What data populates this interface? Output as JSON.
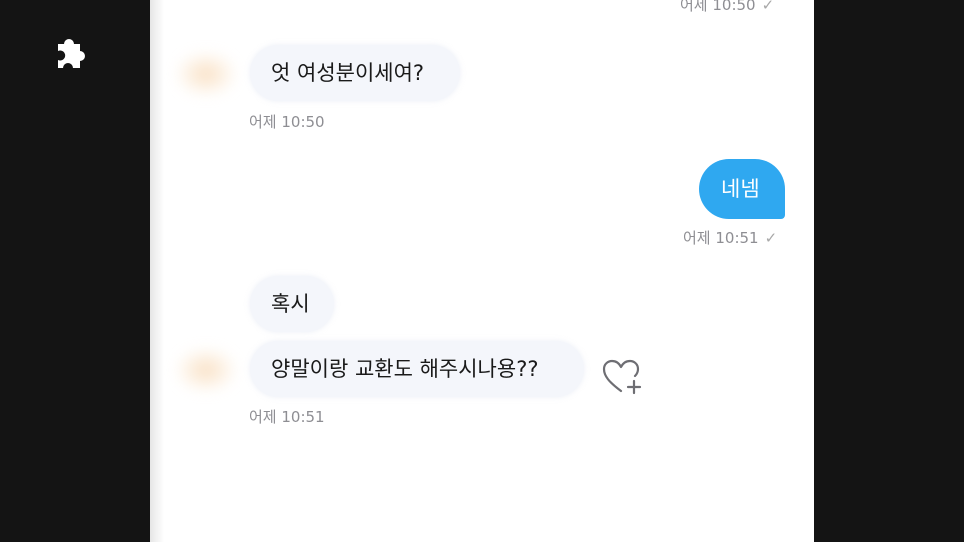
{
  "chat": {
    "messages": [
      {
        "kind": "outgoing_time_partial",
        "time": "어제 10:50",
        "check": "✓"
      },
      {
        "kind": "incoming",
        "text": "엇 여성분이세여?",
        "time": "어제 10:50"
      },
      {
        "kind": "outgoing",
        "text": "네넴",
        "time": "어제 10:51",
        "check": "✓"
      },
      {
        "kind": "incoming",
        "text": "혹시"
      },
      {
        "kind": "incoming",
        "text": "양말이랑 교환도 해주시나용??",
        "time": "어제 10:51"
      }
    ]
  },
  "colors": {
    "outgoing_bubble": "#2fa8f0",
    "incoming_bubble": "#f4f6fb",
    "background": "#141414"
  },
  "icons": [
    "puzzle-icon",
    "heart-plus-icon",
    "read-check-icon"
  ]
}
